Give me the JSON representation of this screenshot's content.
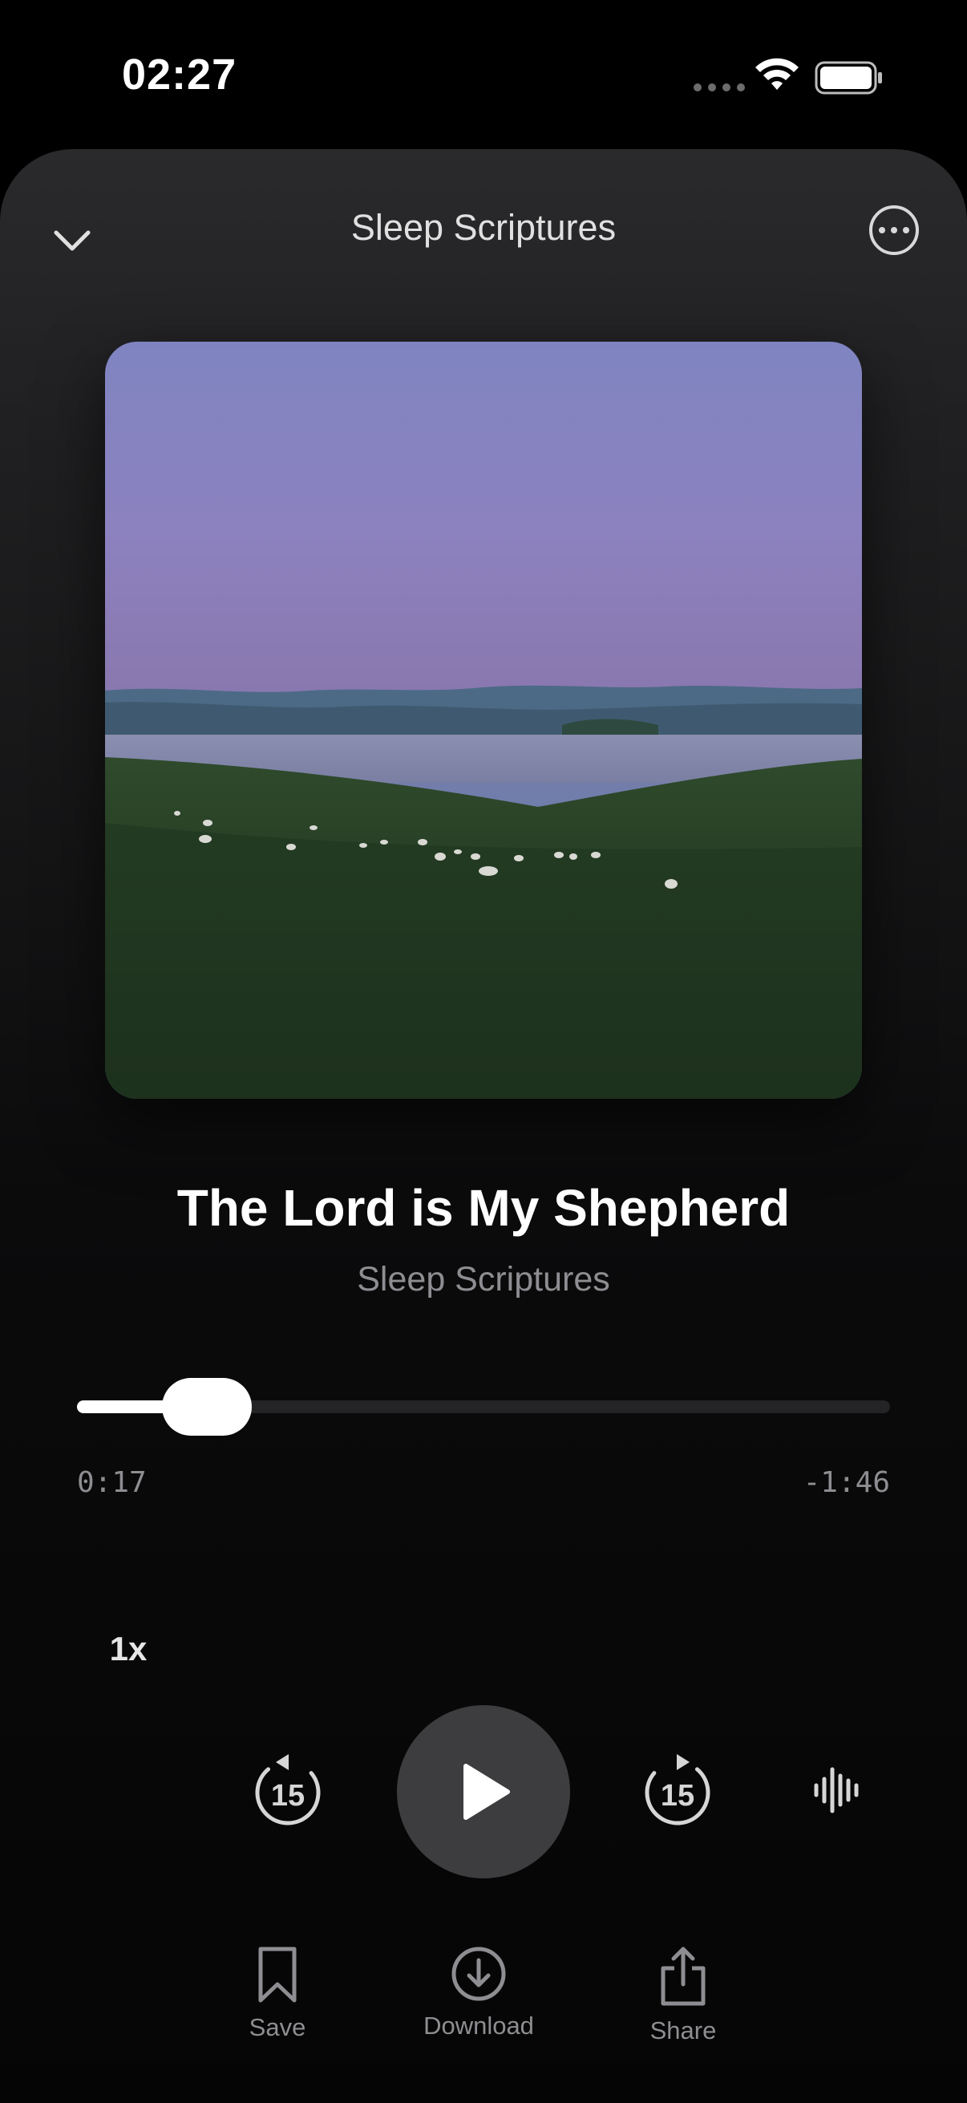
{
  "status_bar": {
    "time": "02:27"
  },
  "header": {
    "title": "Sleep Scriptures",
    "collapse_icon": "chevron-down-icon",
    "more_icon": "ellipsis-circle-icon"
  },
  "track": {
    "title": "The Lord is My Shepherd",
    "artist": "Sleep Scriptures"
  },
  "progress": {
    "elapsed": "0:17",
    "remaining": "-1:46",
    "fraction": 0.16
  },
  "controls": {
    "speed": "1x",
    "skip_back_seconds": "15",
    "skip_forward_seconds": "15",
    "play_icon": "play-icon",
    "waveform_icon": "waveform-icon"
  },
  "actions": {
    "save": "Save",
    "download": "Download",
    "share": "Share"
  },
  "colors": {
    "background": "#000000",
    "play_button": "#3d3d3f",
    "secondary_text": "#8e8e92"
  }
}
